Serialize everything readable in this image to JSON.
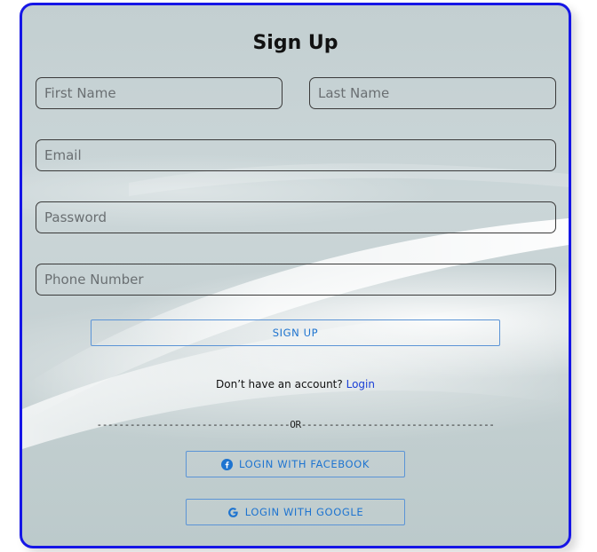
{
  "form": {
    "title": "Sign Up",
    "first_name_placeholder": "First Name",
    "last_name_placeholder": "Last Name",
    "email_placeholder": "Email",
    "password_placeholder": "Password",
    "phone_placeholder": "Phone Number",
    "signup_label": "SIGN UP",
    "account_prompt": "Don’t have an account?",
    "login_link": "Login",
    "divider_text": "-----------------------------------OR-----------------------------------",
    "facebook_label": "LOGIN WITH FACEBOOK",
    "google_label": "LOGIN WITH GOOGLE"
  },
  "colors": {
    "card_border": "#1616e6",
    "button_text": "#1e74d0",
    "link": "#1a3fd6"
  },
  "icons": {
    "facebook": "facebook-icon",
    "google": "google-icon"
  }
}
